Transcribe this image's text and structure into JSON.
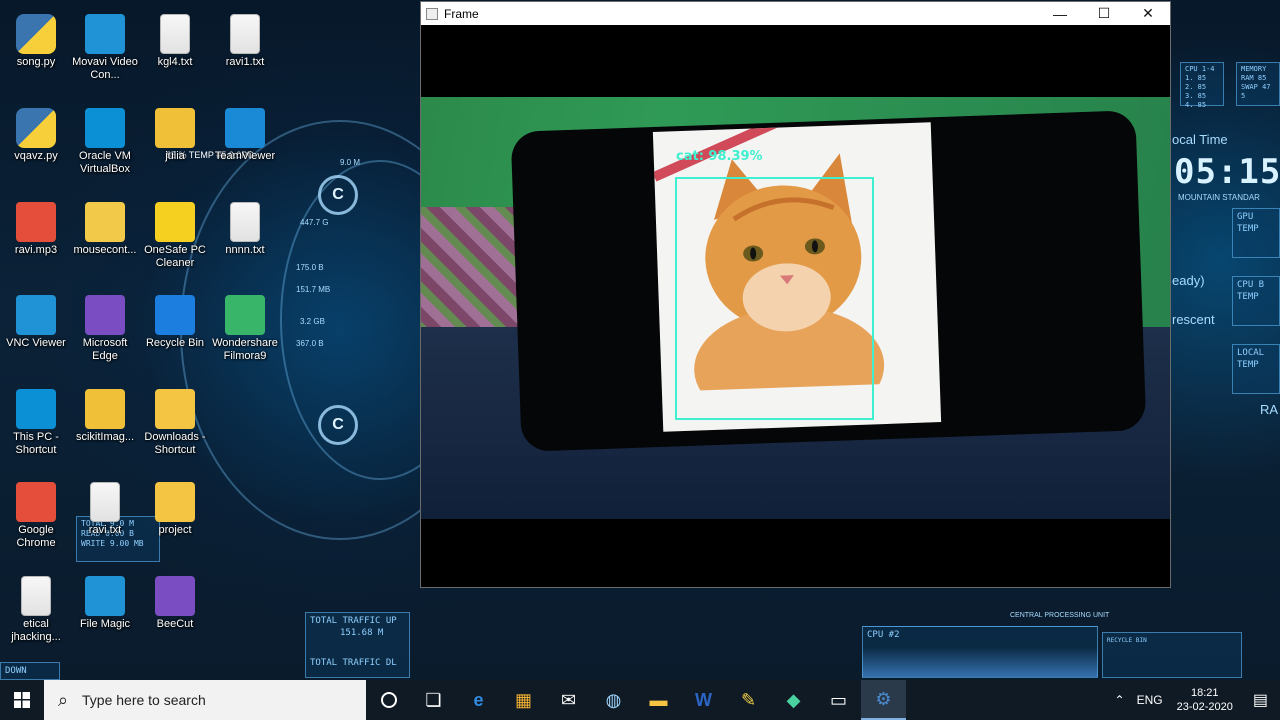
{
  "window": {
    "title": "Frame",
    "controls": {
      "minimize": "—",
      "maximize": "☐",
      "close": "✕"
    },
    "detection": {
      "label": "cat: 98.39%",
      "color": "#3ef0d0"
    }
  },
  "desktop_icons": [
    {
      "label": "song.py",
      "kind": "python"
    },
    {
      "label": "Movavi Video Con...",
      "kind": "app"
    },
    {
      "label": "kgl4.txt",
      "kind": "file"
    },
    {
      "label": "ravi1.txt",
      "kind": "file"
    },
    {
      "label": "vqavz.py",
      "kind": "python"
    },
    {
      "label": "Oracle VM VirtualBox",
      "kind": "app"
    },
    {
      "label": "julia",
      "kind": "app"
    },
    {
      "label": "TeamViewer",
      "kind": "app"
    },
    {
      "label": "ravi.mp3",
      "kind": "media"
    },
    {
      "label": "mousecont...",
      "kind": "app"
    },
    {
      "label": "OneSafe PC Cleaner",
      "kind": "app"
    },
    {
      "label": "nnnn.txt",
      "kind": "file"
    },
    {
      "label": "VNC Viewer",
      "kind": "app"
    },
    {
      "label": "Microsoft Edge",
      "kind": "app"
    },
    {
      "label": "Recycle Bin",
      "kind": "app"
    },
    {
      "label": "Wondershare Filmora9",
      "kind": "app"
    },
    {
      "label": "This PC - Shortcut",
      "kind": "app"
    },
    {
      "label": "scikitImag...",
      "kind": "app"
    },
    {
      "label": "Downloads - Shortcut",
      "kind": "folder"
    },
    {
      "label": "Google Chrome",
      "kind": "app"
    },
    {
      "label": "ravi.txt",
      "kind": "file"
    },
    {
      "label": "project",
      "kind": "folder"
    },
    {
      "label": "etical jhacking...",
      "kind": "file"
    },
    {
      "label": "File Magic",
      "kind": "app"
    },
    {
      "label": "BeeCut",
      "kind": "app"
    }
  ],
  "wallpaper": {
    "clock": "05:15",
    "local_time_label": "ocal Time",
    "mountain_label": "MOUNTAIN STANDAR",
    "ready_label": "eady)",
    "crescent_label": "rescent",
    "traffic_up_label": "TOTAL TRAFFIC UP",
    "traffic_up_value": "151.68 M",
    "traffic_down_label": "TOTAL TRAFFIC DL",
    "cpu_label": "CPU #2",
    "cpu_panel": "CPU 1-4\n1. 85\n2. 85\n3. 85\n4. 85",
    "mem_panel": "MEMORY\nRAM 85\nSWAP 47\n5",
    "gauge_letter": "C",
    "temp_label": "TEMP",
    "gpu_label": "GPU",
    "cpu_b_label": "CPU B",
    "local_label": "LOCAL",
    "ra_label": "RA",
    "down_label": "DOWN",
    "cpu_procs_label": "CENTRAL PROCESSING UNIT",
    "recycle_label": "RECYCLE BIN",
    "julia_temp": "85 % TEMP #5 0.0PC",
    "hud_values": [
      "9.0 M",
      "447.7 G",
      "175.0 B",
      "151.7 MB",
      "3.2 GB",
      "367.0 B"
    ],
    "ravi_panel": "TOTAL 9.0 M\nREAD 0.00 B\nWRITE 9.00 MB"
  },
  "taskbar": {
    "search_placeholder": "Type here to search",
    "language": "ENG",
    "time": "18:21",
    "date": "23-02-2020"
  },
  "colors": {
    "taskbar": "#101a24",
    "detection_box": "#3ef0d0",
    "title_bar": "#ffffff"
  }
}
